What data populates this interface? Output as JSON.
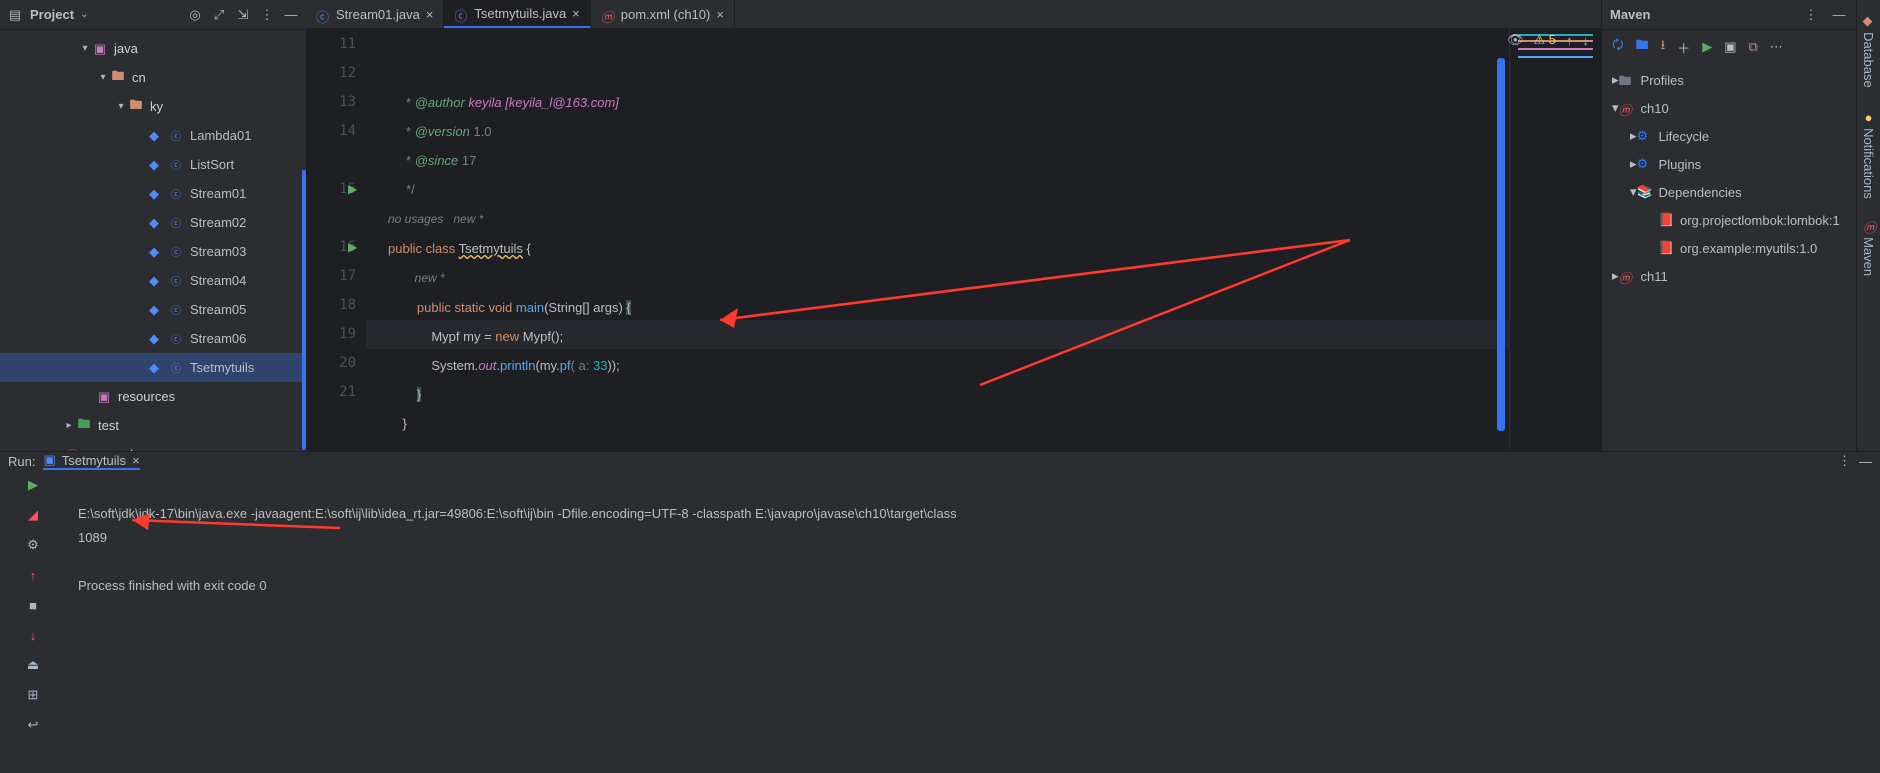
{
  "project": {
    "title": "Project",
    "tree": {
      "java": "java",
      "cn": "cn",
      "ky": "ky",
      "files": [
        "Lambda01",
        "ListSort",
        "Stream01",
        "Stream02",
        "Stream03",
        "Stream04",
        "Stream05",
        "Stream06",
        "Tsetmytuils"
      ],
      "resources": "resources",
      "test": "test",
      "pom": "pom.xml"
    }
  },
  "editorTabs": [
    {
      "label": "Stream01.java",
      "active": false,
      "icon": "class"
    },
    {
      "label": "Tsetmytuils.java",
      "active": true,
      "icon": "class"
    },
    {
      "label": "pom.xml (ch10)",
      "active": false,
      "icon": "maven"
    }
  ],
  "toolbar": {
    "issues": "5"
  },
  "code": {
    "lines": {
      "11": {
        "pre": "     * ",
        "tag": "@author",
        "rest": " keyila [keyila_l@163.com]",
        "style": "doc"
      },
      "12": {
        "pre": "     * ",
        "tag": "@version",
        "rest": " 1.0",
        "style": "doc"
      },
      "13": {
        "pre": "     * ",
        "tag": "@since",
        "rest": " 17",
        "style": "doc"
      },
      "14": {
        "text": "     */",
        "style": "doc"
      },
      "hint1": "no usages   new *",
      "15": {
        "kw": "public class ",
        "cls": "Tsetmytuils",
        "rest": " {"
      },
      "hint2": "        new *",
      "16": {
        "indent": "        ",
        "kw": "public static void ",
        "fn": "main",
        "sig": "(String[] args) ",
        "brace": "{"
      },
      "17": {
        "indent": "            ",
        "t1": "Mypf ",
        "t2": "my = ",
        "kw": "new ",
        "t3": "Mypf();"
      },
      "18": {
        "indent": "            ",
        "t1": "System.",
        "t2": "out",
        ".": ".",
        "fn": "println",
        "open": "(my.",
        "fn2": "pf",
        "args": "( a: ",
        "num": "33",
        "close": "));"
      },
      "19": {
        "indent": "        ",
        "brace": "}"
      },
      "20": {
        "indent": "    ",
        "brace": "}"
      },
      "21": {
        "text": ""
      }
    },
    "firstLine": 11,
    "lastLine": 21
  },
  "maven": {
    "title": "Maven",
    "nodes": {
      "profiles": "Profiles",
      "ch10": "ch10",
      "lifecycle": "Lifecycle",
      "plugins": "Plugins",
      "deps": "Dependencies",
      "dep1": "org.projectlombok:lombok:1",
      "dep2": "org.example:myutils:1.0",
      "ch11": "ch11"
    }
  },
  "rightStrip": {
    "db": "Database",
    "notif": "Notifications",
    "mvn": "Maven"
  },
  "run": {
    "label": "Run:",
    "tab": "Tsetmytuils",
    "cmd": "E:\\soft\\jdk\\jdk-17\\bin\\java.exe -javaagent:E:\\soft\\ij\\lib\\idea_rt.jar=49806:E:\\soft\\ij\\bin -Dfile.encoding=UTF-8 -classpath E:\\javapro\\javase\\ch10\\target\\class",
    "out": "1089",
    "exit": "Process finished with exit code 0"
  }
}
